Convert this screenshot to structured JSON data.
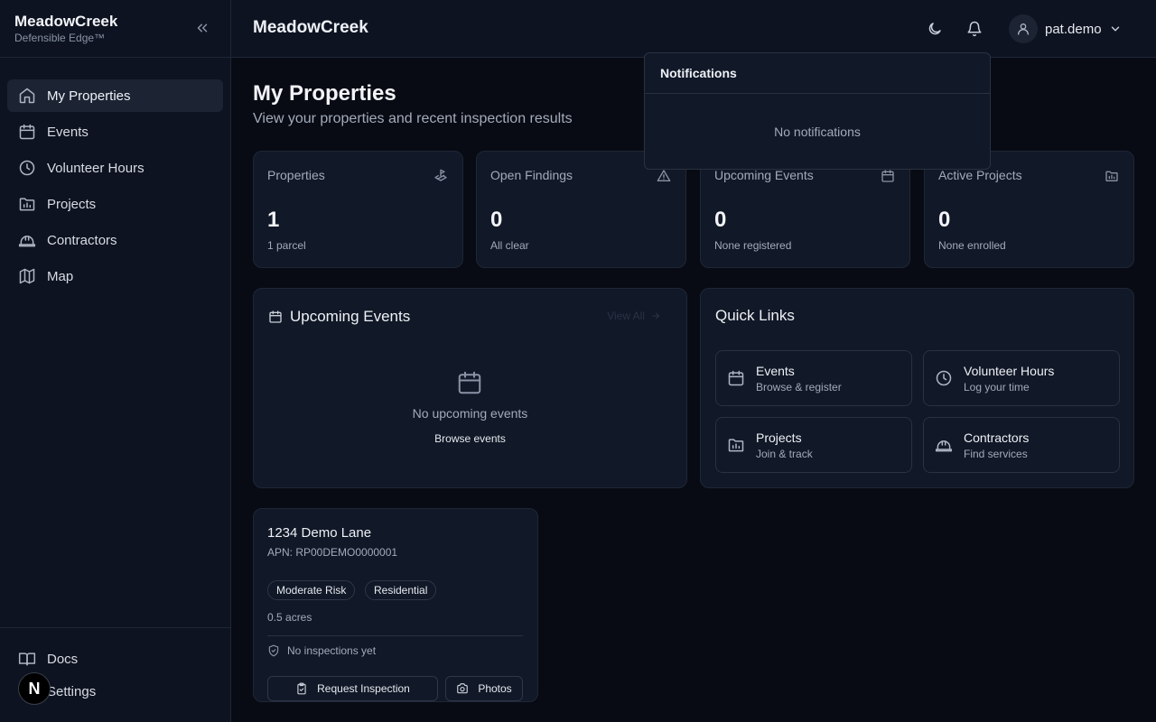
{
  "sidebar": {
    "brand_title": "MeadowCreek",
    "brand_subtitle": "Defensible Edge™",
    "items": [
      {
        "label": "My Properties",
        "icon": "home-icon"
      },
      {
        "label": "Events",
        "icon": "calendar-icon"
      },
      {
        "label": "Volunteer Hours",
        "icon": "clock-icon"
      },
      {
        "label": "Projects",
        "icon": "folder-chart-icon"
      },
      {
        "label": "Contractors",
        "icon": "hard-hat-icon"
      },
      {
        "label": "Map",
        "icon": "map-icon"
      }
    ],
    "bottom_items": [
      {
        "label": "Docs",
        "icon": "book-icon"
      },
      {
        "label": "Settings",
        "icon": "gear-icon"
      }
    ],
    "n_badge": "N"
  },
  "topbar": {
    "title": "MeadowCreek",
    "user_name": "pat.demo"
  },
  "notifications": {
    "title": "Notifications",
    "empty": "No notifications"
  },
  "page": {
    "title": "My Properties",
    "subtitle": "View your properties and recent inspection results"
  },
  "stats": [
    {
      "label": "Properties",
      "value": "1",
      "note": "1 parcel",
      "icon": "land-plot-icon"
    },
    {
      "label": "Open Findings",
      "value": "0",
      "note": "All clear",
      "icon": "warning-icon"
    },
    {
      "label": "Upcoming Events",
      "value": "0",
      "note": "None registered",
      "icon": "calendar-icon"
    },
    {
      "label": "Active Projects",
      "value": "0",
      "note": "None enrolled",
      "icon": "folder-chart-icon"
    }
  ],
  "events_panel": {
    "title": "Upcoming Events",
    "view_all": "View All",
    "empty": "No upcoming events",
    "link": "Browse events"
  },
  "quick_links": {
    "title": "Quick Links",
    "items": [
      {
        "title": "Events",
        "sub": "Browse & register",
        "icon": "calendar-icon"
      },
      {
        "title": "Volunteer Hours",
        "sub": "Log your time",
        "icon": "clock-icon"
      },
      {
        "title": "Projects",
        "sub": "Join & track",
        "icon": "folder-chart-icon"
      },
      {
        "title": "Contractors",
        "sub": "Find services",
        "icon": "hard-hat-icon"
      }
    ]
  },
  "property": {
    "name": "1234 Demo Lane",
    "apn": "APN: RP00DEMO0000001",
    "badges": [
      "Moderate Risk",
      "Residential"
    ],
    "acres": "0.5 acres",
    "inspection": "No inspections yet",
    "request_btn": "Request Inspection",
    "photos_btn": "Photos"
  }
}
